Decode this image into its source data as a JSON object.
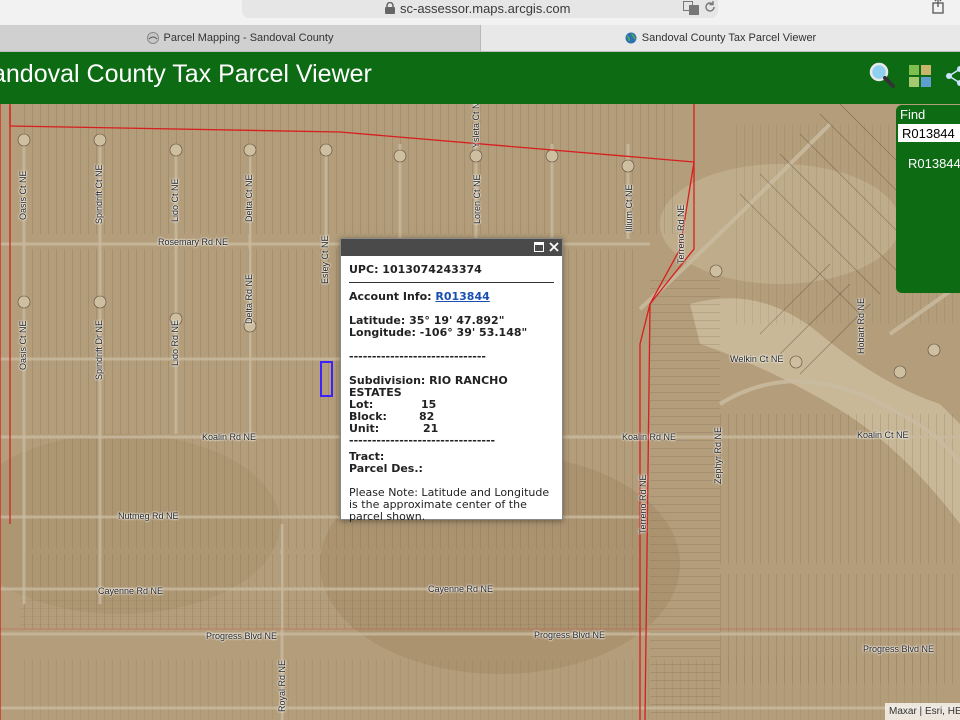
{
  "browser": {
    "url": "sc-assessor.maps.arcgis.com",
    "tabs": [
      {
        "label": "Parcel Mapping - Sandoval County"
      },
      {
        "label": "Sandoval County Tax Parcel Viewer"
      }
    ]
  },
  "app": {
    "title": "andoval County Tax Parcel Viewer",
    "tools": [
      "search-icon",
      "basemap-gallery-icon",
      "share-icon"
    ],
    "header_color": "#0d6b14"
  },
  "find": {
    "title": "Find",
    "input_value": "R013844",
    "result": "R013844"
  },
  "popup": {
    "upc": "UPC: 1013074243374",
    "account_label": "Account Info:",
    "account_value": "R013844",
    "latitude": "Latitude: 35° 19' 47.892\"",
    "longitude": "Longitude: -106° 39' 53.148\"",
    "separator1": "------------------------------",
    "subdivision": "Subdivision: RIO RANCHO ESTATES",
    "lot_label": "Lot:",
    "lot_value": "15",
    "block_label": "Block:",
    "block_value": "82",
    "unit_label": "Unit:",
    "unit_value": "21",
    "separator2": "--------------------------------",
    "tract": "Tract:",
    "parcel_des": "Parcel Des.:",
    "note": "Please Note: Latitude and Longitude is the approximate center of the parcel shown."
  },
  "map": {
    "roads_horizontal": [
      "Rosemary Rd NE",
      "Koalin Rd NE",
      "Koalin Rd NE",
      "Koalin Ct NE",
      "Nutmeg Rd NE",
      "Cayenne Rd NE",
      "Cayenne Rd NE",
      "Progress Blvd NE",
      "Progress Blvd NE",
      "Progress Blvd NE",
      "Welkin Ct NE"
    ],
    "roads_vertical": [
      "Oasis Ct NE",
      "Spindrift Ct NE",
      "Lido Ct NE",
      "Delta Ct NE",
      "Oasis Ct NE",
      "Spindrift Dr NE",
      "Lido Rd NE",
      "Delta Rd NE",
      "Esley Ct NE",
      "Ysleta Ct NE",
      "Loren Ct NE",
      "Illium Ct NE",
      "Terreno Rd NE",
      "Terreno Rd NE",
      "Zephyr Rd NE",
      "Hobart Rd NE",
      "Royal Rd NE"
    ],
    "attribution": "Maxar | Esri, HE",
    "boundary_color": "#d81e1e",
    "selection_color": "#3b22ff"
  }
}
